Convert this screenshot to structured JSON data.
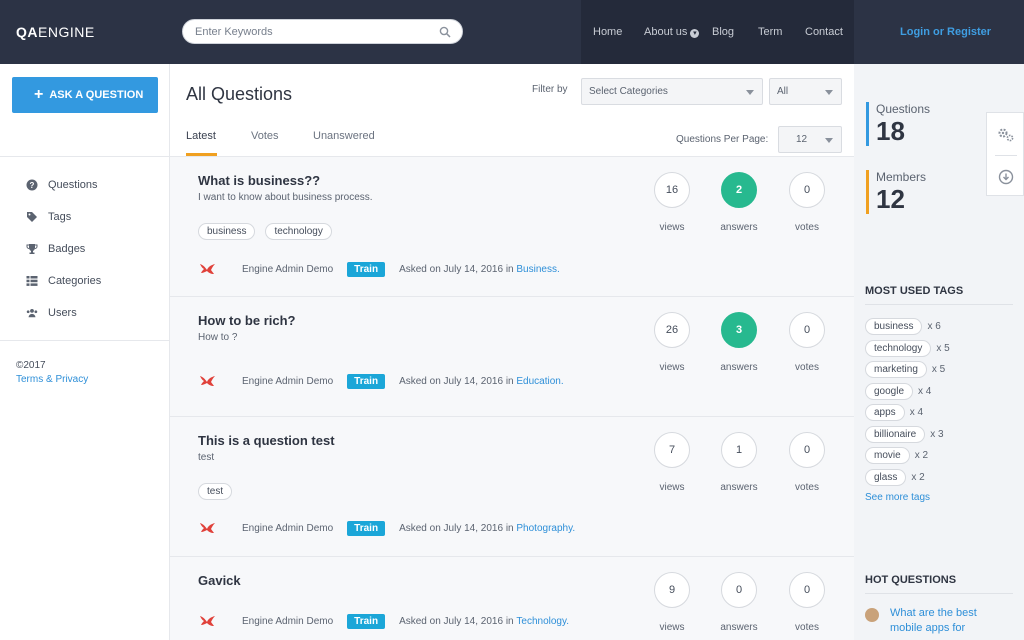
{
  "header": {
    "logo_bold": "QA",
    "logo_rest": "ENGINE",
    "search_placeholder": "Enter Keywords",
    "nav": [
      "Home",
      "About us",
      "Blog",
      "Term",
      "Contact"
    ],
    "login": "Login or Register"
  },
  "sidebar": {
    "ask_label": "ASK A QUESTION",
    "items": [
      {
        "label": "Questions",
        "icon": "question-circle-icon"
      },
      {
        "label": "Tags",
        "icon": "tags-icon"
      },
      {
        "label": "Badges",
        "icon": "trophy-icon"
      },
      {
        "label": "Categories",
        "icon": "list-icon"
      },
      {
        "label": "Users",
        "icon": "users-icon"
      }
    ],
    "copyright": "©2017",
    "terms": "Terms & Privacy"
  },
  "main": {
    "title": "All Questions",
    "filter_label": "Filter by",
    "category_select": "Select Categories",
    "all_select": "All",
    "tabs": [
      "Latest",
      "Votes",
      "Unanswered"
    ],
    "per_page_label": "Questions Per Page:",
    "per_page_value": "12",
    "questions": [
      {
        "title": "What is business??",
        "excerpt": "I want to know about business process.",
        "tags": [
          "business",
          "technology"
        ],
        "author": "Engine Admin Demo",
        "badge": "Train",
        "asked": "Asked on July 14, 2016 in",
        "category": "Business.",
        "views": "16",
        "answers": "2",
        "votes": "0"
      },
      {
        "title": "How to be rich?",
        "excerpt": "How to ?",
        "tags": [],
        "author": "Engine Admin Demo",
        "badge": "Train",
        "asked": "Asked on July 14, 2016 in",
        "category": "Education.",
        "views": "26",
        "answers": "3",
        "votes": "0"
      },
      {
        "title": "This is a question test",
        "excerpt": "test",
        "tags": [
          "test"
        ],
        "author": "Engine Admin Demo",
        "badge": "Train",
        "asked": "Asked on July 14, 2016 in",
        "category": "Photography.",
        "views": "7",
        "answers": "1",
        "votes": "0"
      },
      {
        "title": "Gavick",
        "excerpt": "",
        "tags": [],
        "author": "Engine Admin Demo",
        "badge": "Train",
        "asked": "Asked on July 14, 2016 in",
        "category": "Technology.",
        "views": "9",
        "answers": "0",
        "votes": "0"
      }
    ],
    "stat_labels": {
      "views": "views",
      "answers": "answers",
      "votes": "votes"
    }
  },
  "right": {
    "questions_label": "Questions",
    "questions_count": "18",
    "members_label": "Members",
    "members_count": "12",
    "tags_title": "MOST USED TAGS",
    "tags": [
      {
        "name": "business",
        "count": "x 6"
      },
      {
        "name": "technology",
        "count": "x 5"
      },
      {
        "name": "marketing",
        "count": "x 5"
      },
      {
        "name": "google",
        "count": "x 4"
      },
      {
        "name": "apps",
        "count": "x 4"
      },
      {
        "name": "billionaire",
        "count": "x 3"
      },
      {
        "name": "movie",
        "count": "x 2"
      },
      {
        "name": "glass",
        "count": "x 2"
      }
    ],
    "see_more": "See more tags",
    "hot_title": "HOT QUESTIONS",
    "hot_question": "What are the best mobile apps for"
  },
  "colors": {
    "header_bg": "#2c3345",
    "accent_blue": "#3399e0",
    "answered_green": "#27b98f",
    "tab_active": "#f0a020",
    "badge_blue": "#1ba6d8"
  }
}
